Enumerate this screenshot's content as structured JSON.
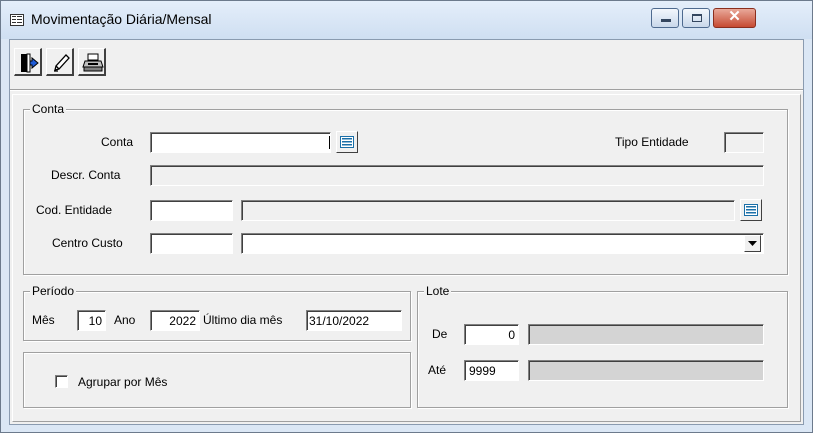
{
  "window": {
    "title": "Movimentação Diária/Mensal",
    "min_icon": "minimize-icon",
    "max_icon": "maximize-icon",
    "close_glyph": "✕"
  },
  "toolbar": {
    "exit_icon": "exit-door-icon",
    "clear_icon": "eraser-icon",
    "print_icon": "printer-icon"
  },
  "conta_group": {
    "caption": "Conta",
    "conta_label": "Conta",
    "conta_value": "",
    "tipo_entidade_label": "Tipo Entidade",
    "tipo_entidade_value": "",
    "descr_conta_label": "Descr. Conta",
    "descr_conta_value": "",
    "cod_entidade_label": "Cod. Entidade",
    "cod_entidade_value": "",
    "entidade_descr_value": "",
    "centro_custo_label": "Centro Custo",
    "centro_custo_value": "",
    "centro_custo_select_value": ""
  },
  "periodo_group": {
    "caption": "Período",
    "mes_label": "Mês",
    "mes_value": "10",
    "ano_label": "Ano",
    "ano_value": "2022",
    "ultimo_dia_label": "Último dia mês",
    "ultimo_dia_value": "31/10/2022"
  },
  "agrupar": {
    "label": "Agrupar por Mês",
    "checked": false
  },
  "lote_group": {
    "caption": "Lote",
    "de_label": "De",
    "de_value": "0",
    "de_descr": "",
    "ate_label": "Até",
    "ate_value": "9999",
    "ate_descr": ""
  }
}
